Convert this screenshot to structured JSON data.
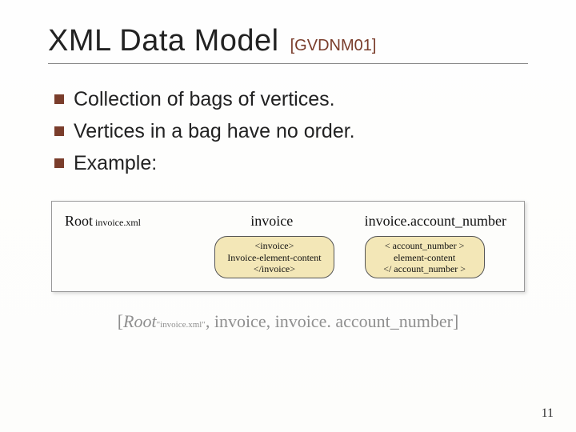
{
  "title": "XML Data Model",
  "title_tag": "[GVDNM01]",
  "bullets": [
    "Collection of bags of vertices.",
    "Vertices in a bag have no order.",
    "Example:"
  ],
  "diagram": {
    "labels": {
      "left_main": "Root",
      "left_sub": " invoice.xml",
      "mid": "invoice",
      "right": "invoice.account_number"
    },
    "boxes": {
      "mid": {
        "line1": "<invoice>",
        "line2": "Invoice-element-content",
        "line3": "</invoice>"
      },
      "right": {
        "line1": "< account_number >",
        "line2": "element-content",
        "line3": "</ account_number >"
      }
    }
  },
  "footer": {
    "open": "[",
    "root": "Root",
    "root_sub": "\"invoice.xml\"",
    "rest": ", invoice, invoice. account_number",
    "close": "]"
  },
  "page_number": "11"
}
